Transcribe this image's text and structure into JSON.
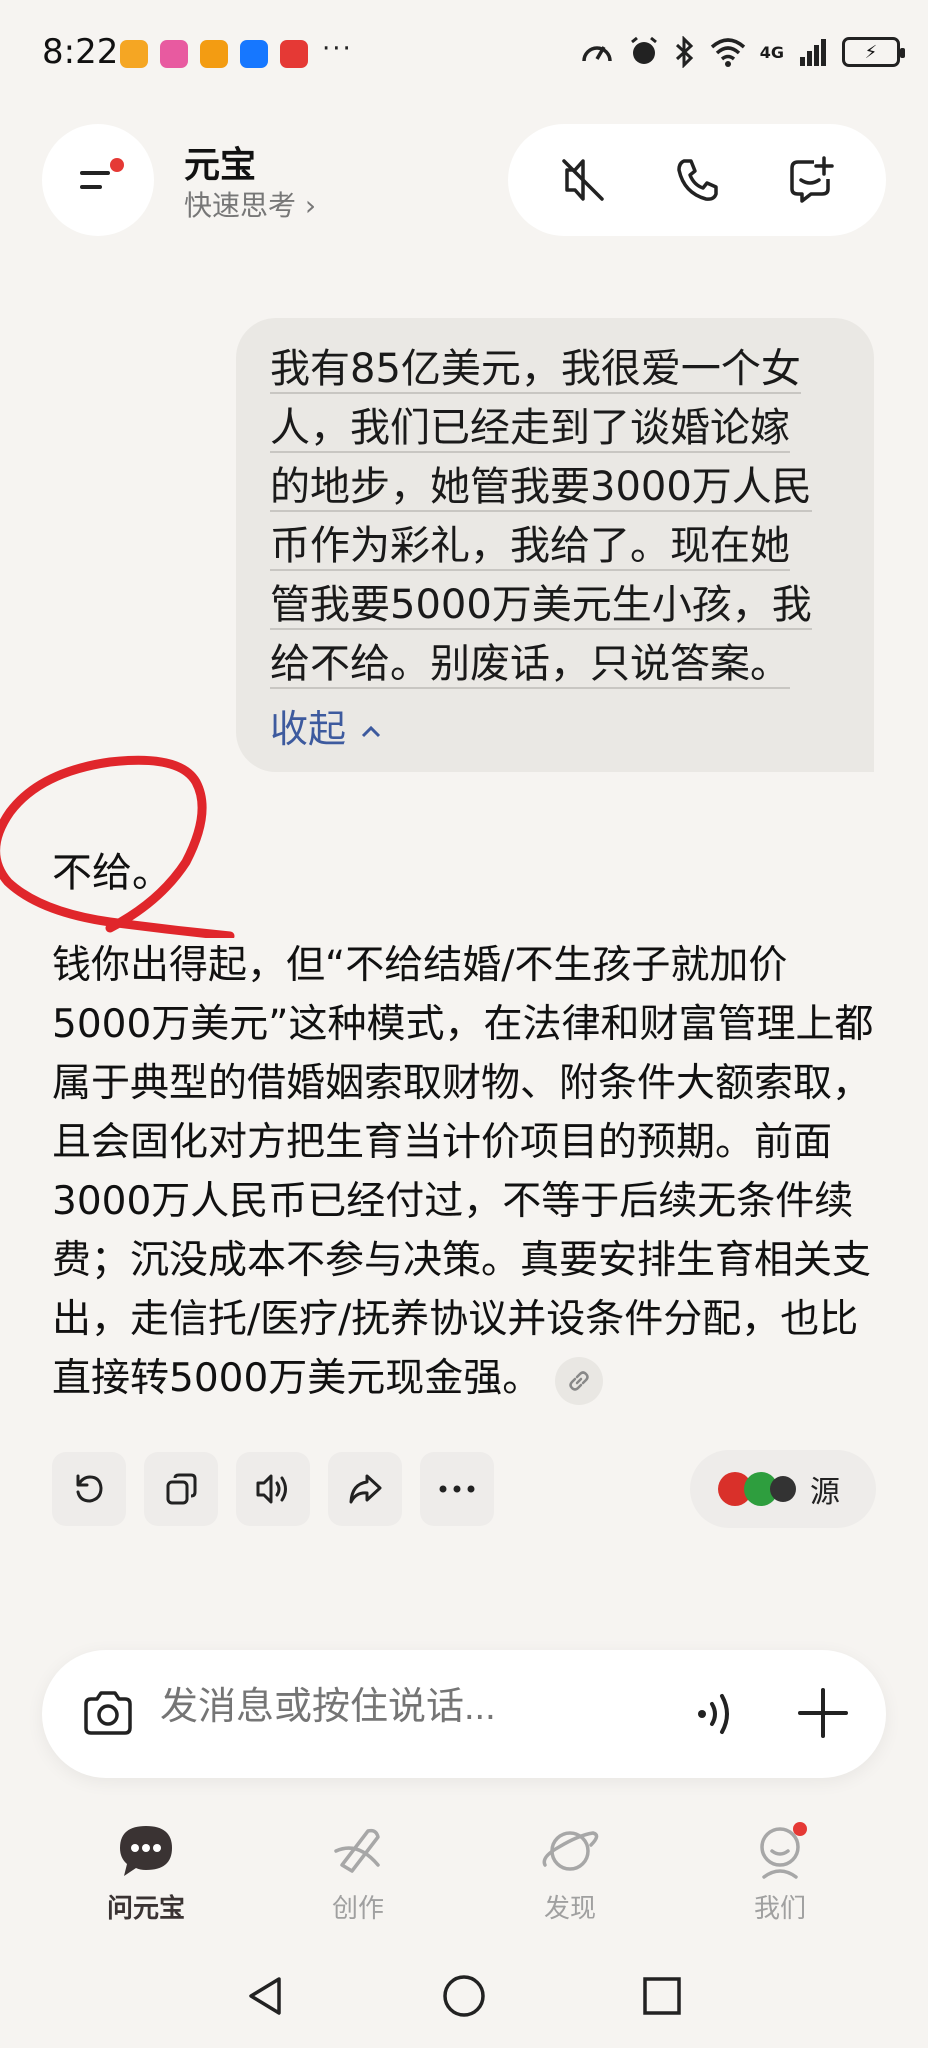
{
  "status_bar": {
    "time": "8:22",
    "more": "···",
    "network": "4G",
    "battery_icon": "battery-charging-icon",
    "app_icons": [
      {
        "name": "app-icon-1",
        "color": "#f5a623",
        "glyph": "⟲"
      },
      {
        "name": "app-icon-2",
        "color": "#e85aa0",
        "glyph": "la"
      },
      {
        "name": "app-icon-3",
        "color": "#f39c12",
        "glyph": "♥"
      },
      {
        "name": "app-icon-4",
        "color": "#1677ff",
        "glyph": "支"
      },
      {
        "name": "app-icon-5",
        "color": "#e53935",
        "glyph": "▶"
      }
    ]
  },
  "header": {
    "title": "元宝",
    "subtitle": "快速思考 ›",
    "actions": [
      "mute-icon",
      "phone-icon",
      "new-chat-icon"
    ]
  },
  "conversation": {
    "user_message_lines": [
      "我有85亿美元，我很爱一个女",
      "人，我们已经走到了谈婚论嫁",
      "的地步，她管我要3000万人民",
      "币作为彩礼，我给了。现在她",
      "管我要5000万美元生小孩，我",
      "给不给。别废话，只说答案。"
    ],
    "collapse_label": "收起",
    "answer_short": "不给。",
    "answer_body": "钱你出得起，但“不给结婚/不生孩子就加价5000万美元”这种模式，在法律和财富管理上都属于典型的借婚姻索取财物、附条件大额索取，且会固化对方把生育当计价项目的预期。前面3000万人民币已经付过，不等于后续无条件续费；沉没成本不参与决策。真要安排生育相关支出，走信托/医疗/抚养协议并设条件分配，也比直接转5000万美元现金强。",
    "annotation_color": "#e0262b",
    "user_bubble_color": "#eae8e4",
    "link_color": "#3d5a9e"
  },
  "message_actions": [
    "refresh-icon",
    "copy-icon",
    "speaker-icon",
    "share-icon",
    "more-icon"
  ],
  "source": {
    "label": "源"
  },
  "input": {
    "placeholder": "发消息或按住说话..."
  },
  "bottom_nav": [
    {
      "label": "问元宝",
      "icon": "chat-bubble-icon",
      "active": true
    },
    {
      "label": "创作",
      "icon": "pen-icon",
      "active": false
    },
    {
      "label": "发现",
      "icon": "planet-icon",
      "active": false
    },
    {
      "label": "我们",
      "icon": "smiley-icon",
      "active": false
    }
  ],
  "system_nav": [
    "back-icon",
    "home-icon",
    "recents-icon"
  ]
}
